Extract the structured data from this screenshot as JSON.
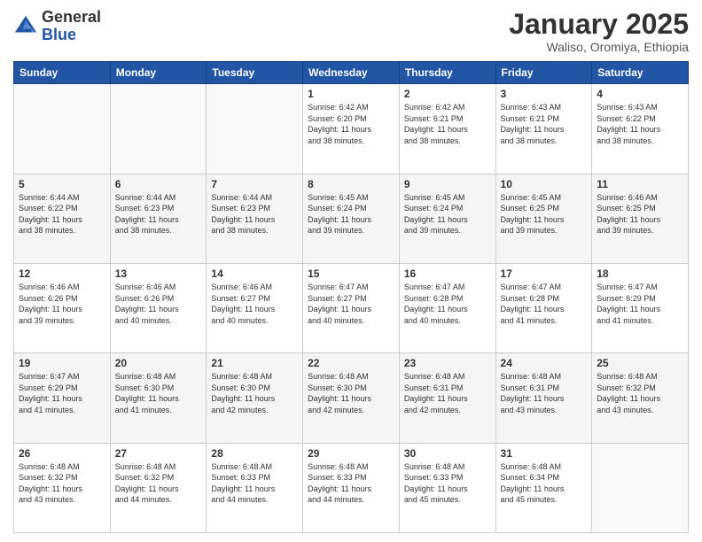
{
  "logo": {
    "general": "General",
    "blue": "Blue"
  },
  "header": {
    "month": "January 2025",
    "location": "Waliso, Oromiya, Ethiopia"
  },
  "weekdays": [
    "Sunday",
    "Monday",
    "Tuesday",
    "Wednesday",
    "Thursday",
    "Friday",
    "Saturday"
  ],
  "weeks": [
    [
      {
        "day": "",
        "info": ""
      },
      {
        "day": "",
        "info": ""
      },
      {
        "day": "",
        "info": ""
      },
      {
        "day": "1",
        "info": "Sunrise: 6:42 AM\nSunset: 6:20 PM\nDaylight: 11 hours\nand 38 minutes."
      },
      {
        "day": "2",
        "info": "Sunrise: 6:42 AM\nSunset: 6:21 PM\nDaylight: 11 hours\nand 38 minutes."
      },
      {
        "day": "3",
        "info": "Sunrise: 6:43 AM\nSunset: 6:21 PM\nDaylight: 11 hours\nand 38 minutes."
      },
      {
        "day": "4",
        "info": "Sunrise: 6:43 AM\nSunset: 6:22 PM\nDaylight: 11 hours\nand 38 minutes."
      }
    ],
    [
      {
        "day": "5",
        "info": "Sunrise: 6:44 AM\nSunset: 6:22 PM\nDaylight: 11 hours\nand 38 minutes."
      },
      {
        "day": "6",
        "info": "Sunrise: 6:44 AM\nSunset: 6:23 PM\nDaylight: 11 hours\nand 38 minutes."
      },
      {
        "day": "7",
        "info": "Sunrise: 6:44 AM\nSunset: 6:23 PM\nDaylight: 11 hours\nand 38 minutes."
      },
      {
        "day": "8",
        "info": "Sunrise: 6:45 AM\nSunset: 6:24 PM\nDaylight: 11 hours\nand 39 minutes."
      },
      {
        "day": "9",
        "info": "Sunrise: 6:45 AM\nSunset: 6:24 PM\nDaylight: 11 hours\nand 39 minutes."
      },
      {
        "day": "10",
        "info": "Sunrise: 6:45 AM\nSunset: 6:25 PM\nDaylight: 11 hours\nand 39 minutes."
      },
      {
        "day": "11",
        "info": "Sunrise: 6:46 AM\nSunset: 6:25 PM\nDaylight: 11 hours\nand 39 minutes."
      }
    ],
    [
      {
        "day": "12",
        "info": "Sunrise: 6:46 AM\nSunset: 6:26 PM\nDaylight: 11 hours\nand 39 minutes."
      },
      {
        "day": "13",
        "info": "Sunrise: 6:46 AM\nSunset: 6:26 PM\nDaylight: 11 hours\nand 40 minutes."
      },
      {
        "day": "14",
        "info": "Sunrise: 6:46 AM\nSunset: 6:27 PM\nDaylight: 11 hours\nand 40 minutes."
      },
      {
        "day": "15",
        "info": "Sunrise: 6:47 AM\nSunset: 6:27 PM\nDaylight: 11 hours\nand 40 minutes."
      },
      {
        "day": "16",
        "info": "Sunrise: 6:47 AM\nSunset: 6:28 PM\nDaylight: 11 hours\nand 40 minutes."
      },
      {
        "day": "17",
        "info": "Sunrise: 6:47 AM\nSunset: 6:28 PM\nDaylight: 11 hours\nand 41 minutes."
      },
      {
        "day": "18",
        "info": "Sunrise: 6:47 AM\nSunset: 6:29 PM\nDaylight: 11 hours\nand 41 minutes."
      }
    ],
    [
      {
        "day": "19",
        "info": "Sunrise: 6:47 AM\nSunset: 6:29 PM\nDaylight: 11 hours\nand 41 minutes."
      },
      {
        "day": "20",
        "info": "Sunrise: 6:48 AM\nSunset: 6:30 PM\nDaylight: 11 hours\nand 41 minutes."
      },
      {
        "day": "21",
        "info": "Sunrise: 6:48 AM\nSunset: 6:30 PM\nDaylight: 11 hours\nand 42 minutes."
      },
      {
        "day": "22",
        "info": "Sunrise: 6:48 AM\nSunset: 6:30 PM\nDaylight: 11 hours\nand 42 minutes."
      },
      {
        "day": "23",
        "info": "Sunrise: 6:48 AM\nSunset: 6:31 PM\nDaylight: 11 hours\nand 42 minutes."
      },
      {
        "day": "24",
        "info": "Sunrise: 6:48 AM\nSunset: 6:31 PM\nDaylight: 11 hours\nand 43 minutes."
      },
      {
        "day": "25",
        "info": "Sunrise: 6:48 AM\nSunset: 6:32 PM\nDaylight: 11 hours\nand 43 minutes."
      }
    ],
    [
      {
        "day": "26",
        "info": "Sunrise: 6:48 AM\nSunset: 6:32 PM\nDaylight: 11 hours\nand 43 minutes."
      },
      {
        "day": "27",
        "info": "Sunrise: 6:48 AM\nSunset: 6:32 PM\nDaylight: 11 hours\nand 44 minutes."
      },
      {
        "day": "28",
        "info": "Sunrise: 6:48 AM\nSunset: 6:33 PM\nDaylight: 11 hours\nand 44 minutes."
      },
      {
        "day": "29",
        "info": "Sunrise: 6:48 AM\nSunset: 6:33 PM\nDaylight: 11 hours\nand 44 minutes."
      },
      {
        "day": "30",
        "info": "Sunrise: 6:48 AM\nSunset: 6:33 PM\nDaylight: 11 hours\nand 45 minutes."
      },
      {
        "day": "31",
        "info": "Sunrise: 6:48 AM\nSunset: 6:34 PM\nDaylight: 11 hours\nand 45 minutes."
      },
      {
        "day": "",
        "info": ""
      }
    ]
  ]
}
